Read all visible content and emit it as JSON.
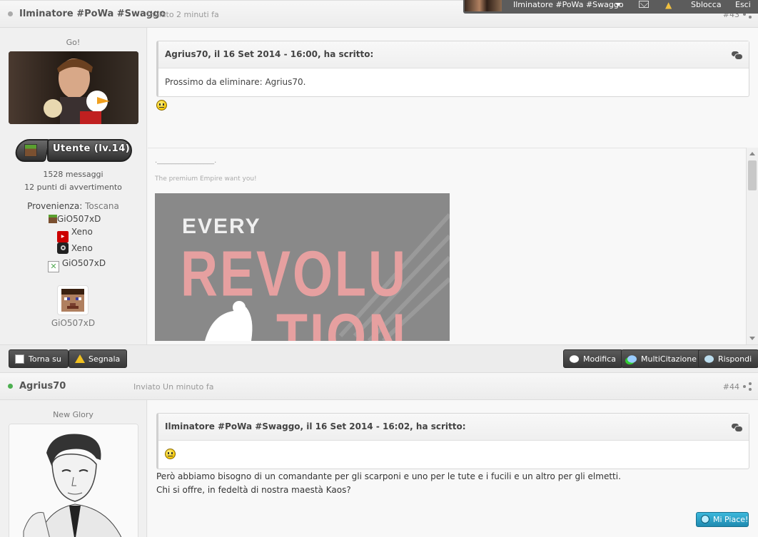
{
  "userbar": {
    "username": "Ilminatore #PoWa #Swaggo",
    "unlock_label": "Sblocca",
    "exit_label": "Esci"
  },
  "post43": {
    "author": "Ilminatore #PoWa #Swaggo",
    "posted": "Inviato 2 minuti fa",
    "number": "#43",
    "rank_title": "Go!",
    "group": "Utente (lv.14)",
    "messages": "1528 messaggi",
    "warnings": "12 punti di avvertimento",
    "location_label": "Provenienza:",
    "location_value": "Toscana",
    "profiles": [
      {
        "icon": "minecraft-icon",
        "label": "GiO507xD"
      },
      {
        "icon": "youtube-icon",
        "label": "Xeno"
      },
      {
        "icon": "steam-icon",
        "label": "Xeno"
      },
      {
        "icon": "xbox-icon",
        "label": "GiO507xD"
      }
    ],
    "skin_label": "GiO507xD",
    "quote_head": "Agrius70, il 16 Set 2014 - 16:00, ha scritto:",
    "quote_body": "Prossimo da eliminare: Agrius70.",
    "signature_line": ".________________.",
    "signature_text": "The premium Empire want you!",
    "signature_banner": {
      "line1": "EVERY",
      "line2": "REVOLU",
      "line3": "TION"
    },
    "buttons_left": [
      "Torna su",
      "Segnala"
    ],
    "buttons_right": [
      "Modifica",
      "MultiCitazione",
      "Rispondi"
    ]
  },
  "post44": {
    "author": "Agrius70",
    "posted": "Inviato Un minuto fa",
    "number": "#44",
    "rank_title": "New Glory",
    "quote_head": "Ilminatore #PoWa #Swaggo, il 16 Set 2014 - 16:02, ha scritto:",
    "body_line1": "Però abbiamo bisogno di un comandante per gli scarponi e uno per le tute e i fucili e un altro per gli elmetti.",
    "body_line2": "Chi si offre, in fedeltà di nostra maestà Kaos?",
    "like_label": "Mi Piace!"
  },
  "colors": {
    "online": "#4caf50",
    "offline": "#aaaaaa",
    "button_dark": "#444444",
    "like_button": "#2a9fc4"
  }
}
